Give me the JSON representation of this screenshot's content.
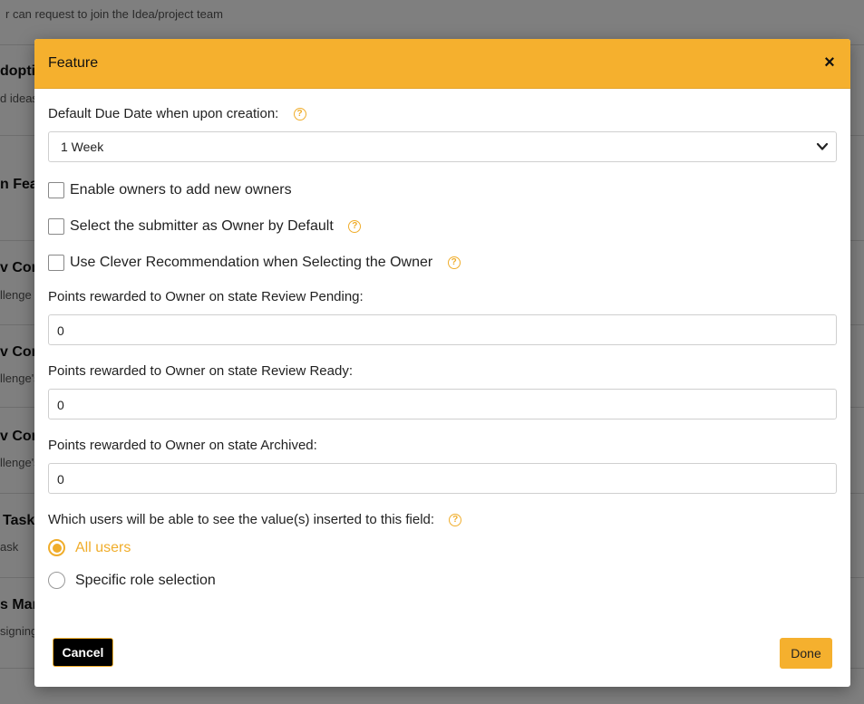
{
  "background": {
    "top_text": "r can request to join the Idea/project team",
    "rows": [
      {
        "title": "doptio",
        "sub": "d ideas"
      },
      {
        "title": "n Fea",
        "sub": ""
      },
      {
        "title": "v Com",
        "sub": "llenge I"
      },
      {
        "title": "v Com",
        "sub": "llenge's"
      },
      {
        "title": "v Com",
        "sub": "llenge's"
      },
      {
        "title": "Task",
        "sub": "ask"
      },
      {
        "title": "s Mar",
        "sub": "signing"
      }
    ]
  },
  "modal": {
    "title": "Feature",
    "close_label": "×",
    "due_date": {
      "label": "Default Due Date when upon creation:",
      "selected": "1 Week"
    },
    "checkboxes": [
      {
        "label": "Enable owners to add new owners",
        "checked": false
      },
      {
        "label": "Select the submitter as Owner by Default",
        "checked": false
      },
      {
        "label": "Use Clever Recommendation when Selecting the Owner",
        "checked": false
      }
    ],
    "points": [
      {
        "label": "Points rewarded to Owner on state Review Pending:",
        "value": "0"
      },
      {
        "label": "Points rewarded to Owner on state Review Ready:",
        "value": "0"
      },
      {
        "label": "Points rewarded to Owner on state Archived:",
        "value": "0"
      }
    ],
    "visibility": {
      "label": "Which users will be able to see the value(s) inserted to this field:",
      "options": [
        {
          "label": "All users",
          "selected": true
        },
        {
          "label": "Specific role selection",
          "selected": false
        }
      ]
    },
    "cancel_label": "Cancel",
    "done_label": "Done"
  },
  "colors": {
    "accent": "#f5b02e",
    "overlay": "rgba(0,0,0,0.5)"
  },
  "icons": {
    "help": "question-circle-icon",
    "select_arrow": "chevron-down-icon",
    "close": "close-icon"
  }
}
